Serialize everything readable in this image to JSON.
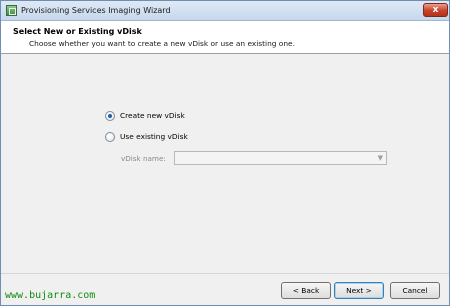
{
  "window": {
    "title": "Provisioning Services Imaging Wizard",
    "close_glyph": "x"
  },
  "header": {
    "title": "Select New or Existing vDisk",
    "subtitle": "Choose whether you want to create a new vDisk or use an existing one."
  },
  "options": {
    "create_new": {
      "label": "Create new vDisk",
      "checked": true
    },
    "use_existing": {
      "label": "Use existing vDisk",
      "checked": false
    },
    "vdisk_name_label": "vDisk name:",
    "vdisk_name_value": ""
  },
  "buttons": {
    "back": "< Back",
    "next": "Next >",
    "cancel": "Cancel"
  },
  "watermark": "www.bujarra.com",
  "colors": {
    "watermark": "#0d8c0d",
    "close_button": "#c8412a",
    "radio_dot": "#1f5fa8"
  }
}
